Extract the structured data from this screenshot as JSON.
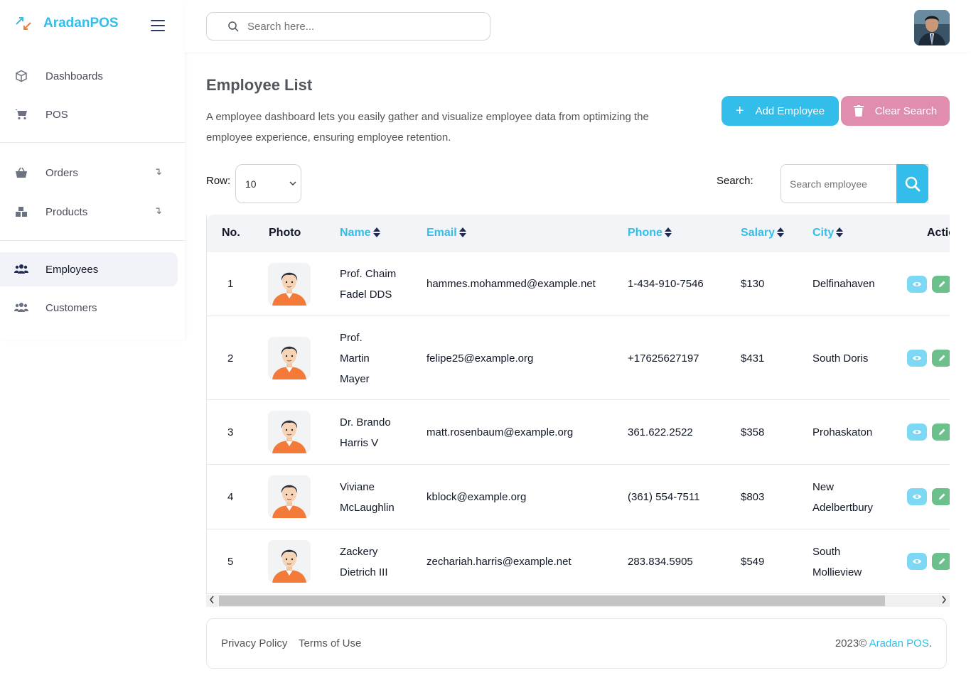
{
  "brand": {
    "name": "AradanPOS",
    "accent": "#32bdea"
  },
  "sidebar": {
    "items": [
      {
        "label": "Dashboards",
        "icon": "cube-icon"
      },
      {
        "label": "POS",
        "icon": "cart-icon"
      },
      {
        "label": "Orders",
        "icon": "basket-icon",
        "arrow": "↴"
      },
      {
        "label": "Products",
        "icon": "boxes-icon",
        "arrow": "↴"
      },
      {
        "label": "Employees",
        "icon": "users-icon",
        "active": true
      },
      {
        "label": "Customers",
        "icon": "users-icon"
      }
    ]
  },
  "topbar": {
    "search_placeholder": "Search here..."
  },
  "page": {
    "title": "Employee List",
    "description": "A employee dashboard lets you easily gather and visualize employee data from optimizing the employee experience, ensuring employee retention.",
    "add_button": "Add Employee",
    "clear_button": "Clear Search",
    "add_color": "#32bdea",
    "clear_color": "#e08db0"
  },
  "controls": {
    "row_label": "Row:",
    "row_value": "10",
    "search_label": "Search:",
    "search_placeholder": "Search employee"
  },
  "table": {
    "headers": {
      "no": "No.",
      "photo": "Photo",
      "name": "Name",
      "email": "Email",
      "phone": "Phone",
      "salary": "Salary",
      "city": "City",
      "action": "Action"
    },
    "rows": [
      {
        "no": "1",
        "name": "Prof. Chaim Fadel DDS",
        "email": "hammes.mohammed@example.net",
        "phone": "1-434-910-7546",
        "salary": "$130",
        "city": "Delfinahaven"
      },
      {
        "no": "2",
        "name": "Prof. Martin Mayer",
        "email": "felipe25@example.org",
        "phone": "+17625627197",
        "salary": "$431",
        "city": "South Doris"
      },
      {
        "no": "3",
        "name": "Dr. Brando Harris V",
        "email": "matt.rosenbaum@example.org",
        "phone": "361.622.2522",
        "salary": "$358",
        "city": "Prohaskaton"
      },
      {
        "no": "4",
        "name": "Viviane McLaughlin",
        "email": "kblock@example.org",
        "phone": "(361) 554-7511",
        "salary": "$803",
        "city": "New Adelbertbury"
      },
      {
        "no": "5",
        "name": "Zackery Dietrich III",
        "email": "zechariah.harris@example.net",
        "phone": "283.834.5905",
        "salary": "$549",
        "city": "South Mollieview"
      }
    ]
  },
  "footer": {
    "privacy": "Privacy Policy",
    "terms": "Terms of Use",
    "copyright": "2023©",
    "brand_link": "Aradan POS",
    "period": "."
  }
}
